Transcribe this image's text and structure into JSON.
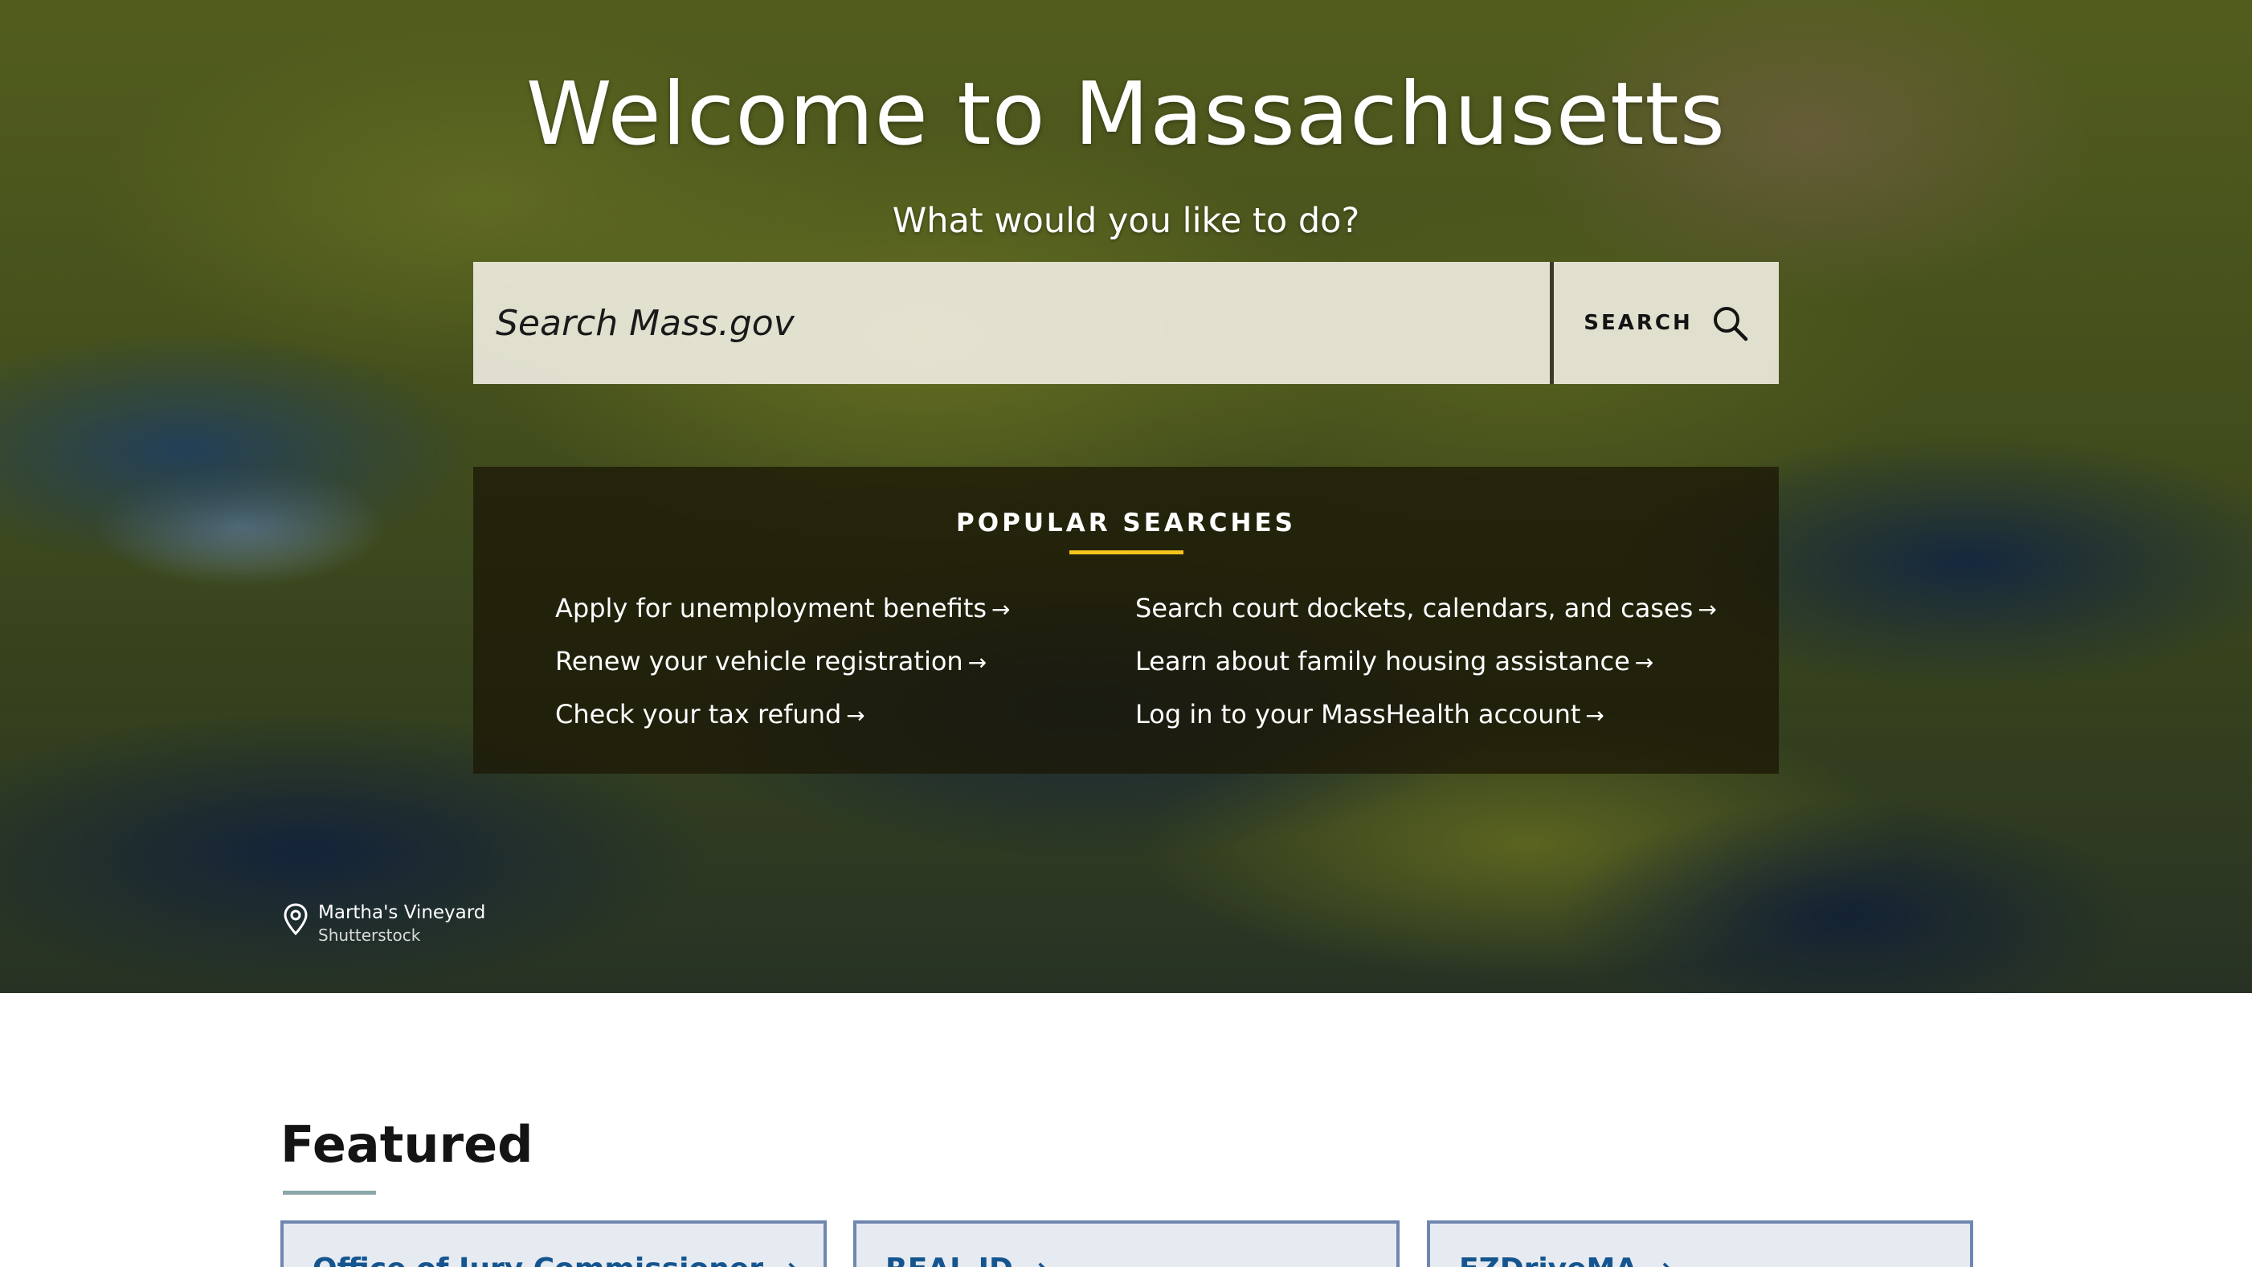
{
  "hero": {
    "title": "Welcome to Massachusetts",
    "subtitle": "What would you like to do?"
  },
  "search": {
    "placeholder": "Search Mass.gov",
    "button_label": "SEARCH"
  },
  "popular_searches": {
    "heading": "POPULAR SEARCHES",
    "left": [
      {
        "label": "Apply for unemployment benefits"
      },
      {
        "label": "Renew your vehicle registration"
      },
      {
        "label": "Check your tax refund"
      }
    ],
    "right": [
      {
        "label": "Search court dockets, calendars, and cases"
      },
      {
        "label": "Learn about family housing assistance"
      },
      {
        "label": "Log in to your MassHealth account"
      }
    ],
    "arrow": "→"
  },
  "photo_credit": {
    "place": "Martha's Vineyard",
    "source": "Shutterstock"
  },
  "featured": {
    "title": "Featured",
    "cards": [
      {
        "label": "Office of Jury Commissioner →"
      },
      {
        "label": "REAL ID →"
      },
      {
        "label": "EZDriveMA →"
      }
    ]
  },
  "colors": {
    "accent_gold": "#f6c51b",
    "link_blue": "#14558f",
    "card_border": "#6f87b0",
    "card_bg": "#e6eaf1"
  }
}
